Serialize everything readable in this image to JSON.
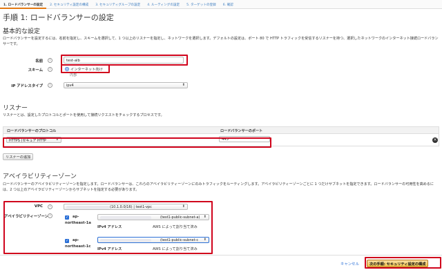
{
  "tabs": [
    {
      "label": "1. ロードバランサーの設定"
    },
    {
      "label": "2. セキュリティ設定の構成"
    },
    {
      "label": "3. セキュリティグループの設定"
    },
    {
      "label": "4. ルーティングの設定"
    },
    {
      "label": "5. ターゲットの登録"
    },
    {
      "label": "6. 確認"
    }
  ],
  "page_title": "手順 1: ロードバランサーの設定",
  "basic": {
    "heading": "基本的な設定",
    "description": "ロードバランサーを設定するには、名前を指定し、スキームを選択して、1 つ以上のリスナーを指定し、ネットワークを選択します。デフォルトの設定は、ポート 80 で HTTP トラフィックを受信するリスナーを持つ、選択したネットワークのインターネット接続ロードバランサーです。",
    "name_label": "名前",
    "name_value": "test-alb",
    "scheme_label": "スキーム",
    "scheme_option1": "インターネット向け",
    "scheme_option2": "内部",
    "ip_label": "IP アドレスタイプ",
    "ip_value": "ipv4"
  },
  "listeners": {
    "heading": "リスナー",
    "description": "リスナーとは、設定したプロトコルとポートを使用して接続リクエストをチェックするプロセスです。",
    "col_protocol": "ロードバランサーのプロトコル",
    "col_port": "ロードバランサーのポート",
    "protocol_value": "HTTPS (セキュア HTTP",
    "port_value": "443",
    "add_button": "リスナーの追加",
    "remove_icon": "×"
  },
  "az": {
    "heading": "アベイラビリティーゾーン",
    "description": "ロードバランサーのアベイラビリティーゾーンを指定します。ロードバランサーは、これらのアベイラビリティーゾーンにのみトラフィックをルーティングします。アベイラビリティーゾーンごとに 1 つだけサブネットを指定できます。ロードバランサーの可用性を高めるには、2 つ以上のアベイラビリティーゾーンからサブネットを指定する必要があります。",
    "vpc_label": "VPC",
    "vpc_value": "(10.1.0.0/16) | test1-vpc",
    "az_label": "アベイラビリティーゾーン",
    "zones": [
      {
        "name_line1": "ap-",
        "name_line2": "northeast-1a",
        "subnet": "(test1-public-subnet-a)",
        "ipv4_label": "IPv4 アドレス",
        "ipv4_value": "AWS によって割り当て済み"
      },
      {
        "name_line1": "ap-",
        "name_line2": "northeast-1c",
        "subnet": "(test1-public-subnet-c",
        "ipv4_label": "IPv4 アドレス",
        "ipv4_value": "AWS によって割り当て済み"
      }
    ]
  },
  "footer": {
    "cancel": "キャンセル",
    "next": "次の手順: セキュリティ設定の構成"
  },
  "icons": {
    "info": "i",
    "check": "✓",
    "select_arrow": "⬍"
  },
  "colors": {
    "accent_red": "#d0021b",
    "link_blue": "#2a6fd6",
    "primary_button": "#f0c14b",
    "active_tab": "#e47911"
  }
}
